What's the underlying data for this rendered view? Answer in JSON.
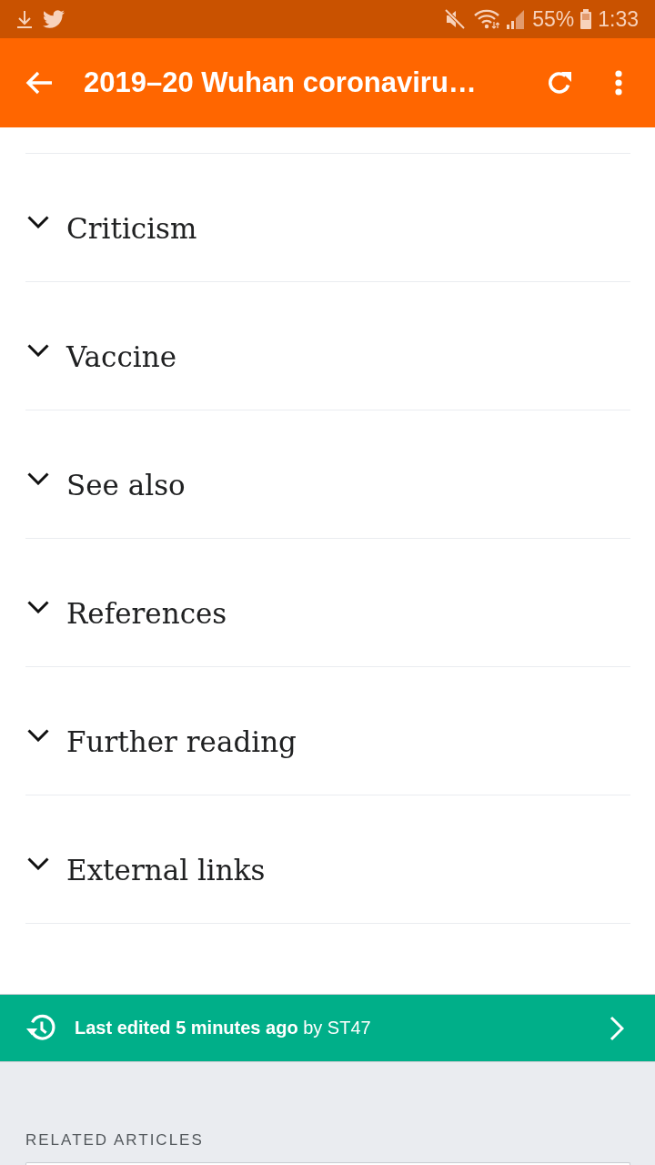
{
  "status_bar": {
    "battery": "55%",
    "time": "1:33"
  },
  "app_bar": {
    "title": "2019–20 Wuhan coronaviru…"
  },
  "sections": [
    {
      "title": "Criticism",
      "expanded": false
    },
    {
      "title": "Vaccine",
      "expanded": false
    },
    {
      "title": "See also",
      "expanded": false
    },
    {
      "title": "References",
      "expanded": false
    },
    {
      "title": "Further reading",
      "expanded": false
    },
    {
      "title": "External links",
      "expanded": false
    }
  ],
  "last_edited": {
    "text": "**Last edited 5 minutes ago** by ST47"
  },
  "related_articles": {
    "heading": "RELATED ARTICLES"
  }
}
